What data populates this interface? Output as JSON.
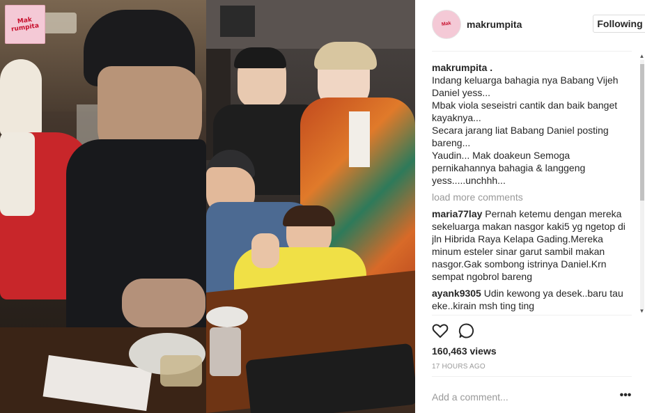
{
  "post": {
    "username": "makrumpita",
    "follow_label": "Following",
    "logo_text_line1": "Mak",
    "logo_text_line2": "rumpita"
  },
  "caption": {
    "username": "makrumpita .",
    "text": "Indang keluarga bahagia nya Babang Vijeh Daniel yess...\nMbak viola seseistri cantik dan baik banget kayaknya...\nSecara jarang liat Babang Daniel posting bareng...\nYaudin... Mak doakeun Semoga pernikahannya bahagia & langgeng yess.....unchhh..."
  },
  "load_more_label": "load more comments",
  "comments": [
    {
      "user": "maria77lay",
      "text": "Pernah ketemu dengan mereka sekeluarga makan nasgor kaki5 yg ngetop di jln Hibrida Raya Kelapa Gading.Mereka minum esteler sinar garut sambil makan nasgor.Gak sombong istrinya Daniel.Krn sempat ngobrol bareng"
    },
    {
      "user": "ayank9305",
      "text": "Udin kewong ya desek..baru tau eke..kirain msh ting ting"
    }
  ],
  "stats": {
    "views": "160,463 views",
    "time": "17 HOURS AGO"
  },
  "comment_input": {
    "placeholder": "Add a comment..."
  },
  "more_label": "•••",
  "icons": [
    "heart-icon",
    "comment-icon",
    "more-options-icon"
  ]
}
